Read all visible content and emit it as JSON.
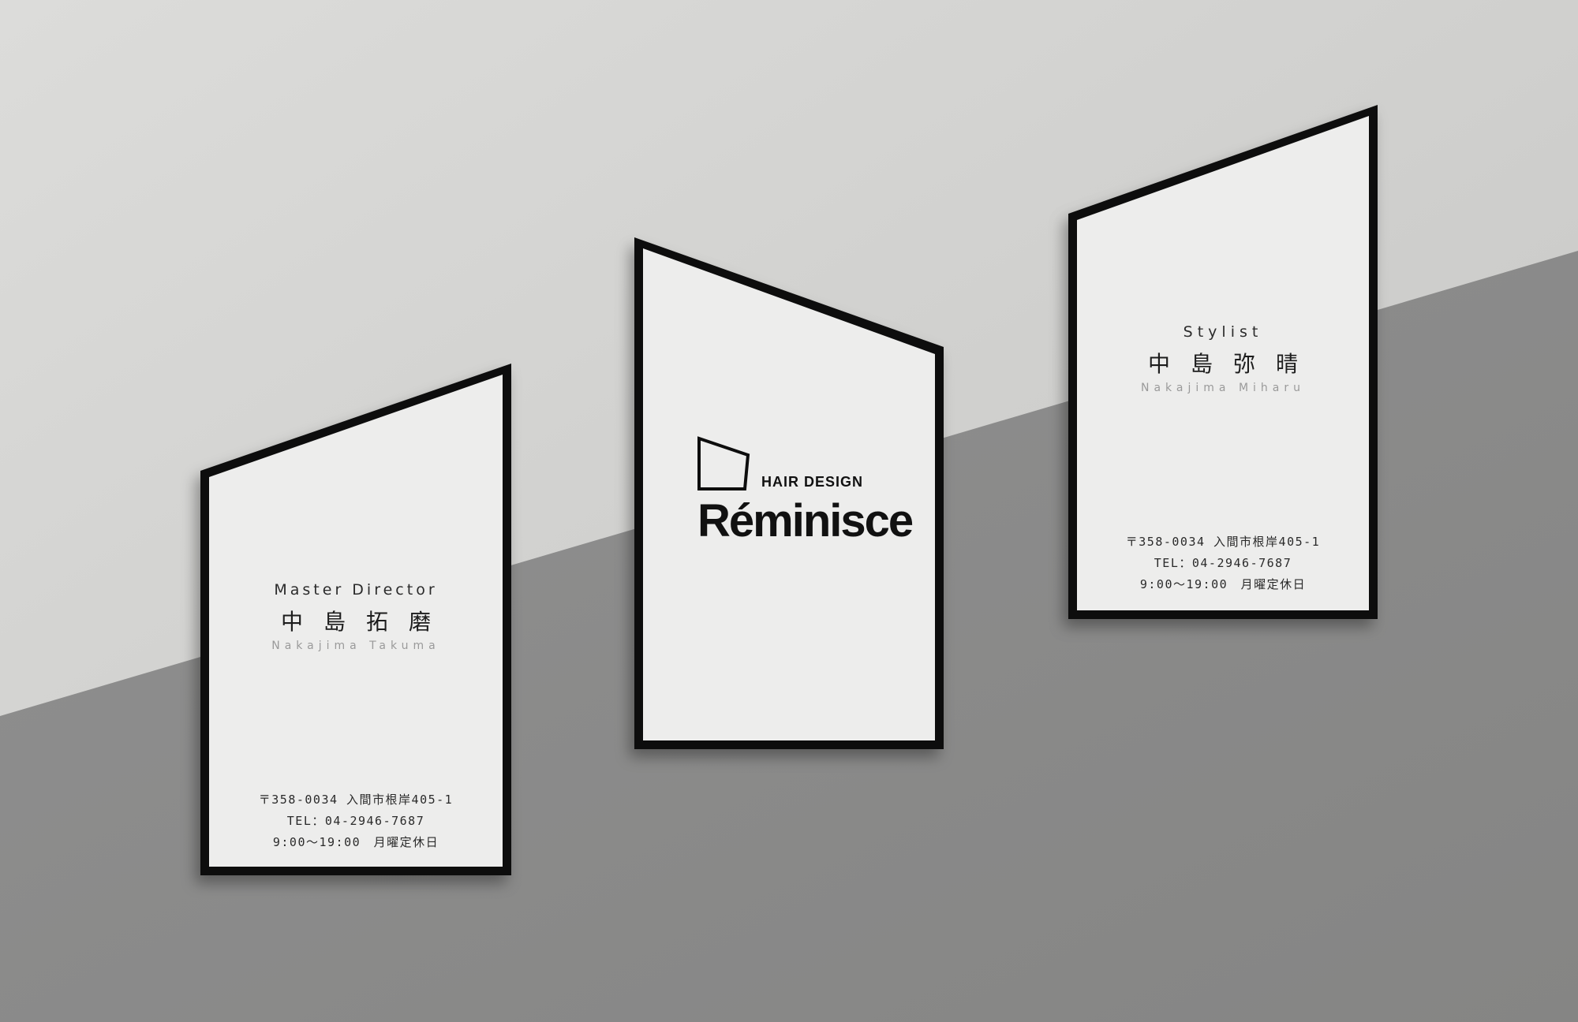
{
  "scene": {
    "colors": {
      "wall_light": "#cfcfcd",
      "wall_dark": "#8a8a88",
      "card_paper": "#ececeb",
      "card_border": "#0d0d0d"
    }
  },
  "cards": {
    "left": {
      "role": "Master Director",
      "name_kanji": "中島拓磨",
      "name_romaji": "Nakajima Takuma",
      "address": "〒358-0034 入間市根岸405-1",
      "tel": "TEL：04-2946-7687",
      "hours": "9:00〜19:00　月曜定休日"
    },
    "center": {
      "brand_small": "HAIR DESIGN",
      "brand_name": "Réminisce",
      "logo_icon": "house-outline-icon"
    },
    "right": {
      "role": "Stylist",
      "name_kanji": "中島弥晴",
      "name_romaji": "Nakajima Miharu",
      "address": "〒358-0034 入間市根岸405-1",
      "tel": "TEL：04-2946-7687",
      "hours": "9:00〜19:00　月曜定休日"
    }
  }
}
